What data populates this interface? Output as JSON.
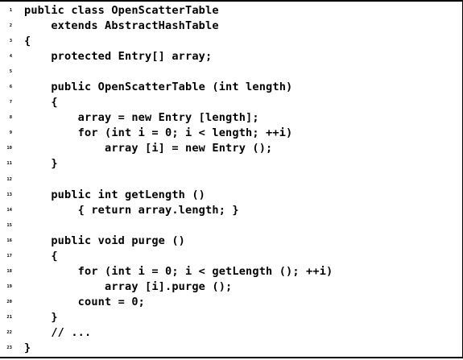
{
  "code": {
    "lines": [
      {
        "number": "1",
        "text": "public class OpenScatterTable"
      },
      {
        "number": "2",
        "text": "    extends AbstractHashTable"
      },
      {
        "number": "3",
        "text": "{"
      },
      {
        "number": "4",
        "text": "    protected Entry[] array;"
      },
      {
        "number": "5",
        "text": ""
      },
      {
        "number": "6",
        "text": "    public OpenScatterTable (int length)"
      },
      {
        "number": "7",
        "text": "    {"
      },
      {
        "number": "8",
        "text": "        array = new Entry [length];"
      },
      {
        "number": "9",
        "text": "        for (int i = 0; i < length; ++i)"
      },
      {
        "number": "10",
        "text": "            array [i] = new Entry ();"
      },
      {
        "number": "11",
        "text": "    }"
      },
      {
        "number": "12",
        "text": ""
      },
      {
        "number": "13",
        "text": "    public int getLength ()"
      },
      {
        "number": "14",
        "text": "        { return array.length; }"
      },
      {
        "number": "15",
        "text": ""
      },
      {
        "number": "16",
        "text": "    public void purge ()"
      },
      {
        "number": "17",
        "text": "    {"
      },
      {
        "number": "18",
        "text": "        for (int i = 0; i < getLength (); ++i)"
      },
      {
        "number": "19",
        "text": "            array [i].purge ();"
      },
      {
        "number": "20",
        "text": "        count = 0;"
      },
      {
        "number": "21",
        "text": "    }"
      },
      {
        "number": "22",
        "text": "    // ..."
      },
      {
        "number": "23",
        "text": "}"
      }
    ]
  }
}
